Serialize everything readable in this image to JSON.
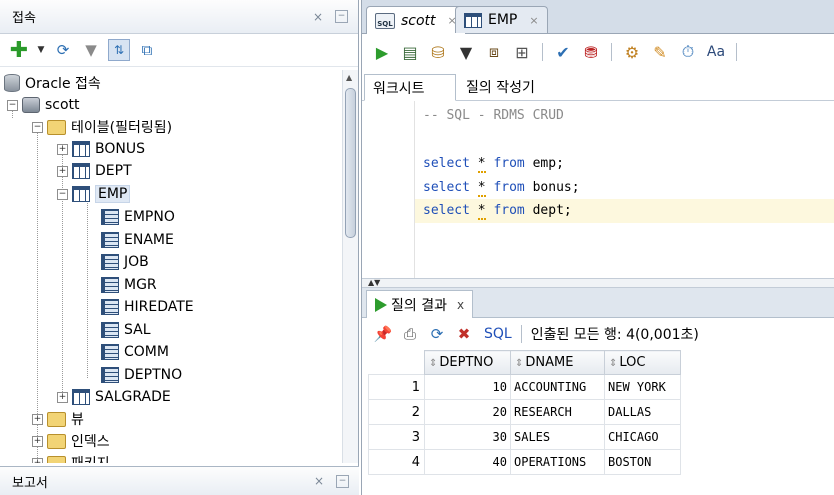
{
  "connections_panel": {
    "title": "접속",
    "toolbar_icons": [
      "add-connection-icon",
      "dropdown-arrow-icon",
      "refresh-icon",
      "filter-icon",
      "schema-browser-icon",
      "tree-view-icon"
    ],
    "tree": {
      "root": "Oracle 접속",
      "connection": "scott",
      "tables_folder": "테이블(필터링됨)",
      "tables": [
        "BONUS",
        "DEPT",
        "EMP"
      ],
      "emp_columns": [
        "EMPNO",
        "ENAME",
        "JOB",
        "MGR",
        "HIREDATE",
        "SAL",
        "COMM",
        "DEPTNO"
      ],
      "more_tables": [
        "SALGRADE"
      ],
      "folders": [
        "뷰",
        "인덱스",
        "패키지"
      ]
    }
  },
  "reports_panel": {
    "title": "보고서"
  },
  "editor_tabs": [
    {
      "label": "scott",
      "active": true
    },
    {
      "label": "EMP",
      "active": false
    }
  ],
  "worksheet_subtabs": [
    "워크시트",
    "질의 작성기"
  ],
  "editor": {
    "comment": "-- SQL - RDMS CRUD",
    "lines": [
      {
        "kw1": "select",
        "star": "*",
        "kw2": "from",
        "rest": " emp;"
      },
      {
        "kw1": "select",
        "star": "*",
        "kw2": "from",
        "rest": " bonus;"
      },
      {
        "kw1": "select",
        "star": "*",
        "kw2": "from",
        "rest": " dept;"
      }
    ]
  },
  "results": {
    "tab_label": "질의 결과",
    "tab_close": "x",
    "sql_link": "SQL",
    "status": "인출된 모든 행: 4(0,001초)",
    "columns": [
      "DEPTNO",
      "DNAME",
      "LOC"
    ],
    "rows": [
      {
        "n": "1",
        "deptno": "10",
        "dname": "ACCOUNTING",
        "loc": "NEW YORK"
      },
      {
        "n": "2",
        "deptno": "20",
        "dname": "RESEARCH",
        "loc": "DALLAS"
      },
      {
        "n": "3",
        "deptno": "30",
        "dname": "SALES",
        "loc": "CHICAGO"
      },
      {
        "n": "4",
        "deptno": "40",
        "dname": "OPERATIONS",
        "loc": "BOSTON"
      }
    ]
  },
  "window_controls": {
    "close": "×",
    "minimize": "−"
  }
}
